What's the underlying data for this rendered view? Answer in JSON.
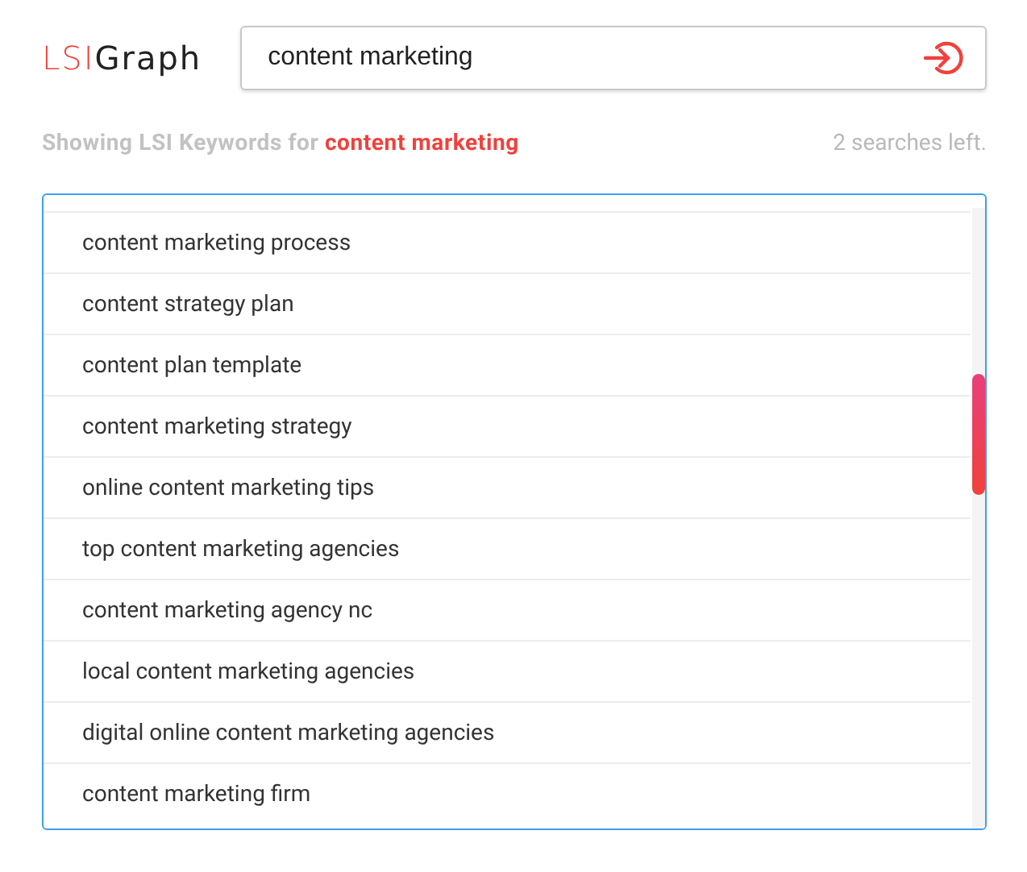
{
  "logo": {
    "accent": "LSI",
    "rest": "Graph"
  },
  "search": {
    "value": "content marketing"
  },
  "results_header": {
    "label": "Showing LSI Keywords for",
    "query": "content marketing",
    "searches_left": "2 searches left."
  },
  "keywords": [
    "content marketing process",
    "content strategy plan",
    "content plan template",
    "content marketing strategy",
    "online content marketing tips",
    "top content marketing agencies",
    "content marketing agency nc",
    "local content marketing agencies",
    "digital online content marketing agencies",
    "content marketing firm"
  ]
}
